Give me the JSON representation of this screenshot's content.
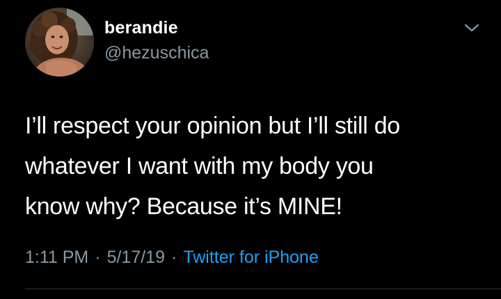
{
  "tweet": {
    "author": {
      "display_name": "berandie",
      "handle": "@hezuschica",
      "avatar_icon": "profile-photo"
    },
    "text": "I’ll respect your opinion but I’ll still do\nwhatever I want with my body you\nknow why? Because it’s MINE!",
    "meta": {
      "time": "1:11 PM",
      "date": "5/17/19",
      "separator": "·",
      "source": "Twitter for iPhone"
    },
    "menu_icon": "chevron-down-icon"
  },
  "colors": {
    "background": "#000000",
    "text": "#ffffff",
    "secondary": "#8899a6",
    "link": "#1da1f2",
    "divider": "#2f3336"
  }
}
